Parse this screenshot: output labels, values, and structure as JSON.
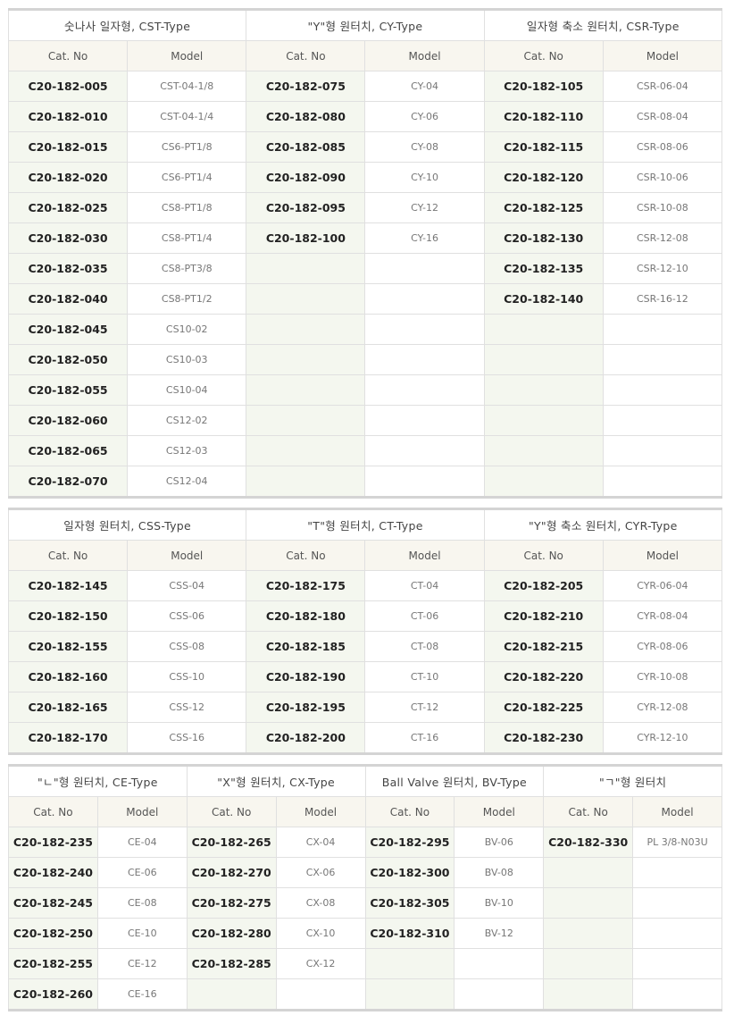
{
  "col_headers": {
    "cat": "Cat. No",
    "model": "Model"
  },
  "blocks": [
    {
      "rows_count": 14,
      "groups": [
        {
          "title": "숫나사 일자형, CST-Type",
          "rows": [
            [
              "C20-182-005",
              "CST-04-1/8"
            ],
            [
              "C20-182-010",
              "CST-04-1/4"
            ],
            [
              "C20-182-015",
              "CS6-PT1/8"
            ],
            [
              "C20-182-020",
              "CS6-PT1/4"
            ],
            [
              "C20-182-025",
              "CS8-PT1/8"
            ],
            [
              "C20-182-030",
              "CS8-PT1/4"
            ],
            [
              "C20-182-035",
              "CS8-PT3/8"
            ],
            [
              "C20-182-040",
              "CS8-PT1/2"
            ],
            [
              "C20-182-045",
              "CS10-02"
            ],
            [
              "C20-182-050",
              "CS10-03"
            ],
            [
              "C20-182-055",
              "CS10-04"
            ],
            [
              "C20-182-060",
              "CS12-02"
            ],
            [
              "C20-182-065",
              "CS12-03"
            ],
            [
              "C20-182-070",
              "CS12-04"
            ]
          ]
        },
        {
          "title": "\"Y\"형 원터치, CY-Type",
          "rows": [
            [
              "C20-182-075",
              "CY-04"
            ],
            [
              "C20-182-080",
              "CY-06"
            ],
            [
              "C20-182-085",
              "CY-08"
            ],
            [
              "C20-182-090",
              "CY-10"
            ],
            [
              "C20-182-095",
              "CY-12"
            ],
            [
              "C20-182-100",
              "CY-16"
            ]
          ]
        },
        {
          "title": "일자형 축소 원터치, CSR-Type",
          "rows": [
            [
              "C20-182-105",
              "CSR-06-04"
            ],
            [
              "C20-182-110",
              "CSR-08-04"
            ],
            [
              "C20-182-115",
              "CSR-08-06"
            ],
            [
              "C20-182-120",
              "CSR-10-06"
            ],
            [
              "C20-182-125",
              "CSR-10-08"
            ],
            [
              "C20-182-130",
              "CSR-12-08"
            ],
            [
              "C20-182-135",
              "CSR-12-10"
            ],
            [
              "C20-182-140",
              "CSR-16-12"
            ]
          ]
        }
      ]
    },
    {
      "rows_count": 6,
      "groups": [
        {
          "title": "일자형 원터치, CSS-Type",
          "rows": [
            [
              "C20-182-145",
              "CSS-04"
            ],
            [
              "C20-182-150",
              "CSS-06"
            ],
            [
              "C20-182-155",
              "CSS-08"
            ],
            [
              "C20-182-160",
              "CSS-10"
            ],
            [
              "C20-182-165",
              "CSS-12"
            ],
            [
              "C20-182-170",
              "CSS-16"
            ]
          ]
        },
        {
          "title": "\"T\"형 원터치, CT-Type",
          "rows": [
            [
              "C20-182-175",
              "CT-04"
            ],
            [
              "C20-182-180",
              "CT-06"
            ],
            [
              "C20-182-185",
              "CT-08"
            ],
            [
              "C20-182-190",
              "CT-10"
            ],
            [
              "C20-182-195",
              "CT-12"
            ],
            [
              "C20-182-200",
              "CT-16"
            ]
          ]
        },
        {
          "title": "\"Y\"형 축소 원터치, CYR-Type",
          "rows": [
            [
              "C20-182-205",
              "CYR-06-04"
            ],
            [
              "C20-182-210",
              "CYR-08-04"
            ],
            [
              "C20-182-215",
              "CYR-08-06"
            ],
            [
              "C20-182-220",
              "CYR-10-08"
            ],
            [
              "C20-182-225",
              "CYR-12-08"
            ],
            [
              "C20-182-230",
              "CYR-12-10"
            ]
          ]
        }
      ]
    },
    {
      "rows_count": 6,
      "groups": [
        {
          "title": "\"ㄴ\"형 원터치, CE-Type",
          "rows": [
            [
              "C20-182-235",
              "CE-04"
            ],
            [
              "C20-182-240",
              "CE-06"
            ],
            [
              "C20-182-245",
              "CE-08"
            ],
            [
              "C20-182-250",
              "CE-10"
            ],
            [
              "C20-182-255",
              "CE-12"
            ],
            [
              "C20-182-260",
              "CE-16"
            ]
          ]
        },
        {
          "title": "\"X\"형 원터치, CX-Type",
          "rows": [
            [
              "C20-182-265",
              "CX-04"
            ],
            [
              "C20-182-270",
              "CX-06"
            ],
            [
              "C20-182-275",
              "CX-08"
            ],
            [
              "C20-182-280",
              "CX-10"
            ],
            [
              "C20-182-285",
              "CX-12"
            ]
          ]
        },
        {
          "title": "Ball Valve 원터치, BV-Type",
          "rows": [
            [
              "C20-182-295",
              "BV-06"
            ],
            [
              "C20-182-300",
              "BV-08"
            ],
            [
              "C20-182-305",
              "BV-10"
            ],
            [
              "C20-182-310",
              "BV-12"
            ]
          ]
        },
        {
          "title": "\"ㄱ\"형 원터치",
          "rows": [
            [
              "C20-182-330",
              "PL 3/8-N03U"
            ]
          ]
        }
      ]
    }
  ]
}
